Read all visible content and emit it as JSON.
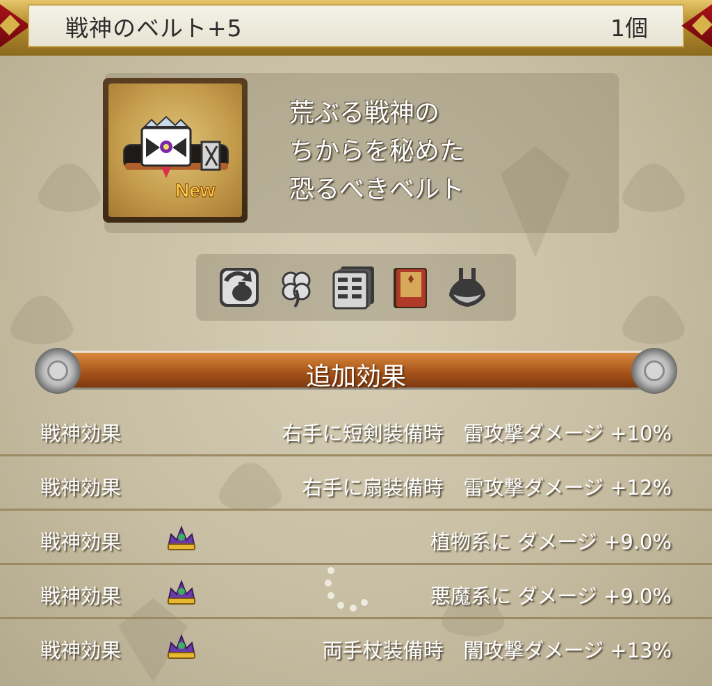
{
  "header": {
    "item_name": "戦神のベルト+5",
    "count": "1個"
  },
  "item": {
    "icon": "belt-icon",
    "new_badge": "New",
    "description": [
      "荒ぶる戦神の",
      "ちからを秘めた",
      "恐るべきベルト"
    ]
  },
  "equip_icons": [
    {
      "name": "bag-cycle-icon"
    },
    {
      "name": "clover-icon"
    },
    {
      "name": "drawer-cabinet-icon"
    },
    {
      "name": "red-book-icon"
    },
    {
      "name": "dress-icon"
    }
  ],
  "section": {
    "title": "追加効果"
  },
  "effects": [
    {
      "label": "戦神効果",
      "crown": false,
      "text": "右手に短剣装備時　雷攻撃ダメージ +10%"
    },
    {
      "label": "戦神効果",
      "crown": false,
      "text": "右手に扇装備時　雷攻撃ダメージ +12%"
    },
    {
      "label": "戦神効果",
      "crown": true,
      "text": "植物系に ダメージ +9.0%"
    },
    {
      "label": "戦神効果",
      "crown": true,
      "text": "悪魔系に ダメージ +9.0%"
    },
    {
      "label": "戦神効果",
      "crown": true,
      "text": "両手杖装備時　闇攻撃ダメージ +13%"
    }
  ],
  "colors": {
    "background": "#cbc3a8",
    "header_gold": "#c9a64c",
    "banner_orange": "#a8541a",
    "text_white": "#ffffff"
  }
}
